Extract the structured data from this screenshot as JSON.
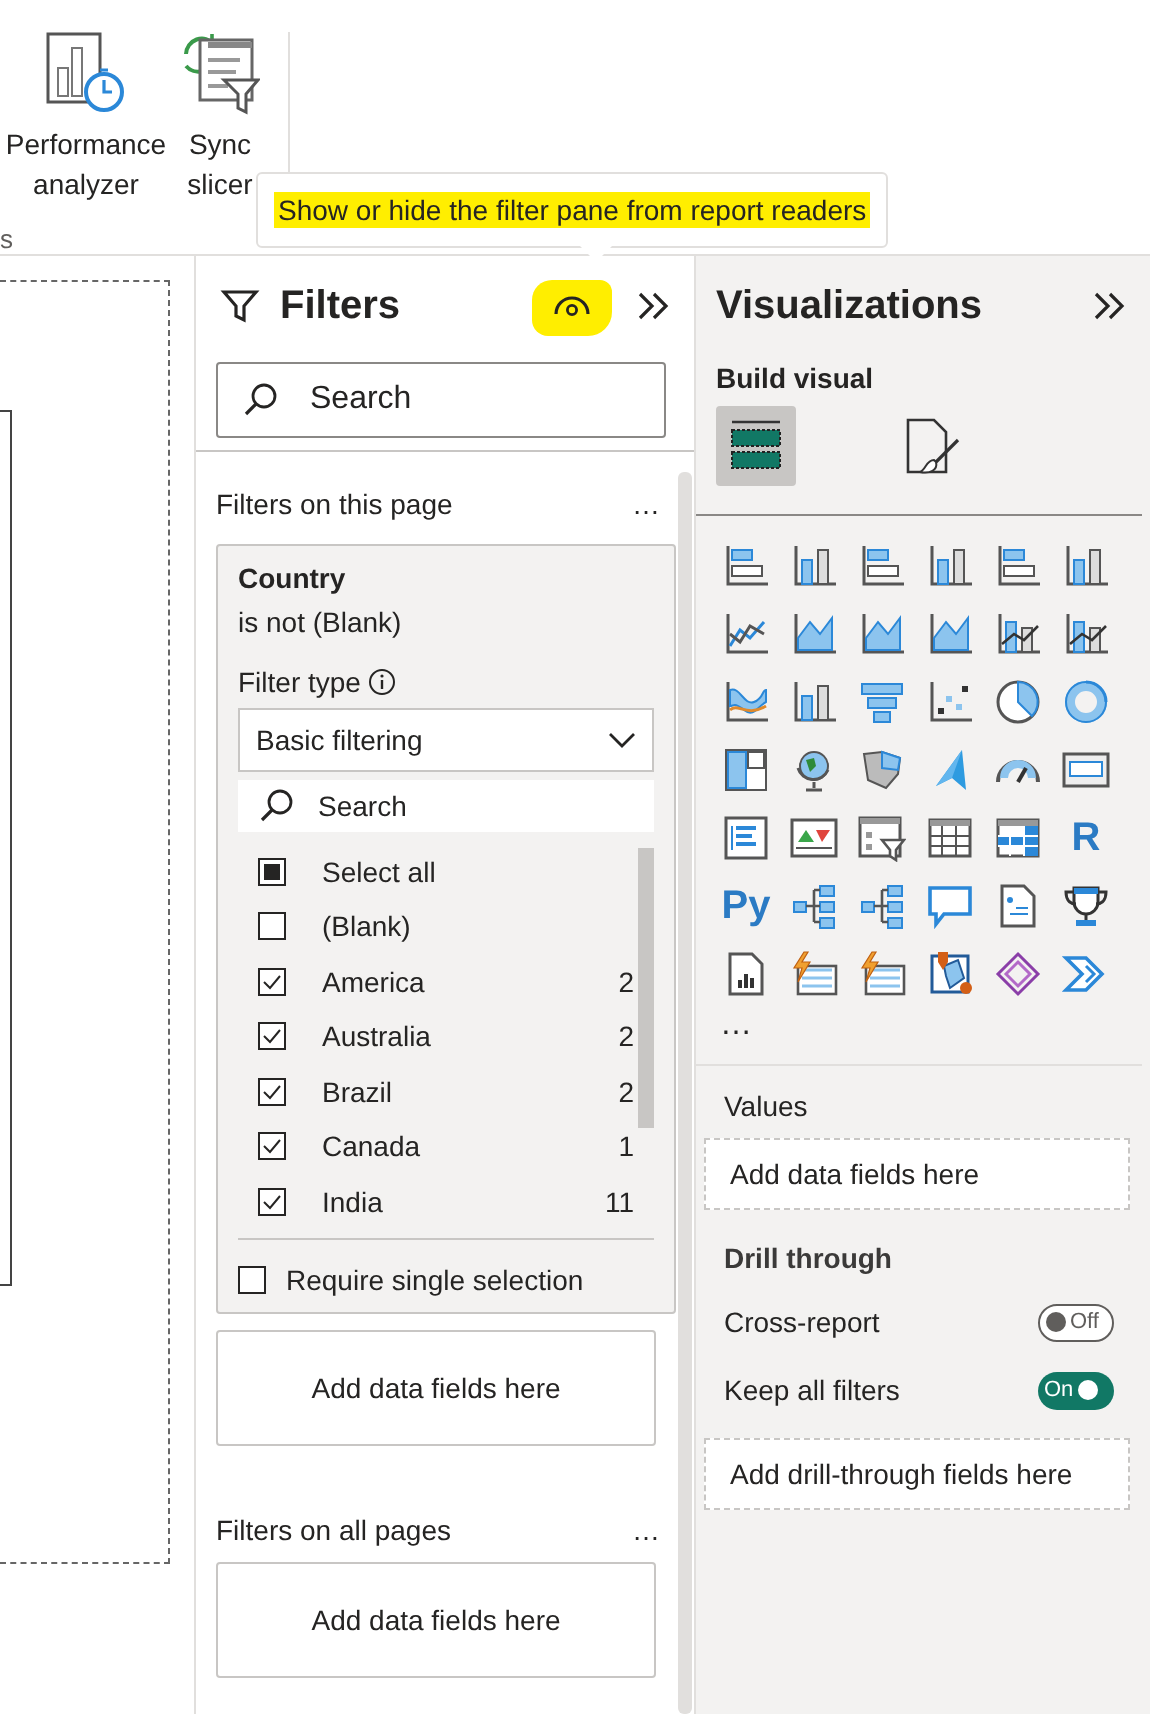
{
  "ribbon": {
    "buttons": [
      {
        "kind": "performance",
        "label": "Performance analyzer"
      },
      {
        "kind": "sync",
        "label": "Sync slicer"
      }
    ],
    "group_label": "s"
  },
  "tooltip": {
    "text": "Show or hide the filter pane from report readers",
    "highlighted": true
  },
  "filters": {
    "title": "Filters",
    "visibility_highlighted": true,
    "search": {
      "placeholder": "Search"
    },
    "page_section": {
      "title": "Filters on this page",
      "more": "…",
      "card": {
        "field": "Country",
        "condition": "is not (Blank)",
        "filter_type_label": "Filter type",
        "filter_type": "Basic filtering",
        "search": {
          "placeholder": "Search"
        },
        "items": [
          {
            "label": "Select all",
            "checked": false,
            "indeterminate": true
          },
          {
            "label": "(Blank)",
            "checked": false,
            "indeterminate": false
          },
          {
            "label": "America",
            "count": "2",
            "checked": true,
            "indeterminate": false
          },
          {
            "label": "Australia",
            "count": "2",
            "checked": true,
            "indeterminate": false
          },
          {
            "label": "Brazil",
            "count": "2",
            "checked": true,
            "indeterminate": false
          },
          {
            "label": "Canada",
            "count": "1",
            "checked": true,
            "indeterminate": false
          },
          {
            "label": "India",
            "count": "11",
            "checked": true,
            "indeterminate": false
          }
        ],
        "require_single": {
          "label": "Require single selection",
          "checked": false
        }
      },
      "drop_zone": "Add data fields here"
    },
    "all_section": {
      "title": "Filters on all pages",
      "more": "…",
      "drop_zone": "Add data fields here"
    }
  },
  "visualizations": {
    "title": "Visualizations",
    "build_label": "Build visual",
    "modes": [
      {
        "kind": "build",
        "selected": true
      },
      {
        "kind": "format",
        "selected": false
      }
    ],
    "visuals": [
      {
        "kind": "bar"
      },
      {
        "kind": "column"
      },
      {
        "kind": "bar"
      },
      {
        "kind": "column"
      },
      {
        "kind": "bar"
      },
      {
        "kind": "column"
      },
      {
        "kind": "line"
      },
      {
        "kind": "area"
      },
      {
        "kind": "area"
      },
      {
        "kind": "area"
      },
      {
        "kind": "combo"
      },
      {
        "kind": "combo"
      },
      {
        "kind": "ribbon"
      },
      {
        "kind": "column"
      },
      {
        "kind": "funnel"
      },
      {
        "kind": "scatter"
      },
      {
        "kind": "pie"
      },
      {
        "kind": "donut"
      },
      {
        "kind": "treemap"
      },
      {
        "kind": "globe"
      },
      {
        "kind": "filled-map"
      },
      {
        "kind": "arrow"
      },
      {
        "kind": "gauge"
      },
      {
        "kind": "card"
      },
      {
        "kind": "list"
      },
      {
        "kind": "kpi"
      },
      {
        "kind": "slicer"
      },
      {
        "kind": "table"
      },
      {
        "kind": "matrix"
      },
      {
        "kind": "letter",
        "label": "R"
      },
      {
        "kind": "letter",
        "label": "Py"
      },
      {
        "kind": "tree"
      },
      {
        "kind": "tree"
      },
      {
        "kind": "speech"
      },
      {
        "kind": "document"
      },
      {
        "kind": "trophy"
      },
      {
        "kind": "report"
      },
      {
        "kind": "lightning"
      },
      {
        "kind": "lightning"
      },
      {
        "kind": "pin"
      },
      {
        "kind": "diamond"
      },
      {
        "kind": "chevrons"
      }
    ],
    "more": "…",
    "values": {
      "label": "Values",
      "drop_zone": "Add data fields here"
    },
    "drill_through": {
      "title": "Drill through",
      "toggles": [
        {
          "label": "Cross-report",
          "on": false,
          "text": "Off"
        },
        {
          "label": "Keep all filters",
          "on": true,
          "text": "On"
        }
      ],
      "drop_zone": "Add drill-through fields here"
    }
  }
}
